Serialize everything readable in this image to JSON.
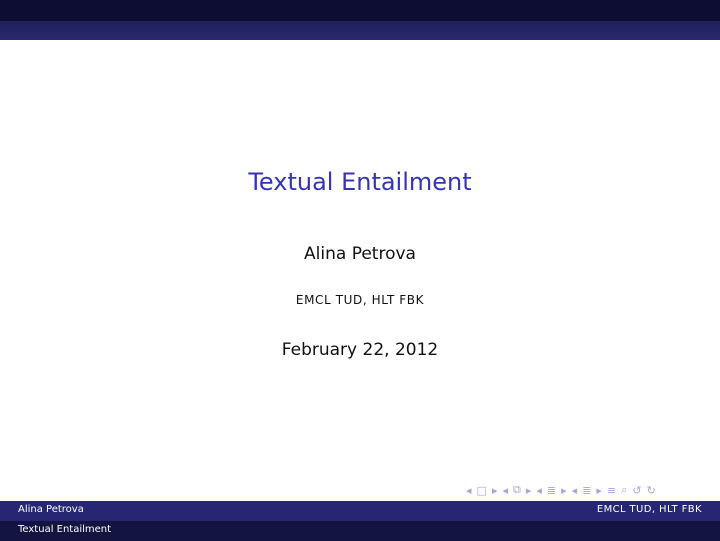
{
  "slide": {
    "title": "Textual Entailment",
    "author": "Alina Petrova",
    "institute": "EMCL TUD, HLT FBK",
    "date": "February 22, 2012"
  },
  "footer": {
    "author": "Alina Petrova",
    "institute": "EMCL TUD, HLT FBK",
    "short_title": "Textual Entailment"
  },
  "nav": {
    "icons": [
      "nav-prev-icon",
      "frame-icon",
      "nav-next-icon",
      "nav-prev-icon",
      "subsection-icon",
      "nav-next-icon",
      "nav-prev-icon",
      "section-icon",
      "nav-next-icon",
      "nav-prev-icon",
      "subsection-icon",
      "nav-next-icon",
      "align-icon",
      "search-icon",
      "undo-icon",
      "redo-icon"
    ]
  },
  "colors": {
    "title": "#3535b3",
    "header_dark": "#0d0d33",
    "footer_top": "#262673",
    "footer_bottom": "#141440"
  }
}
